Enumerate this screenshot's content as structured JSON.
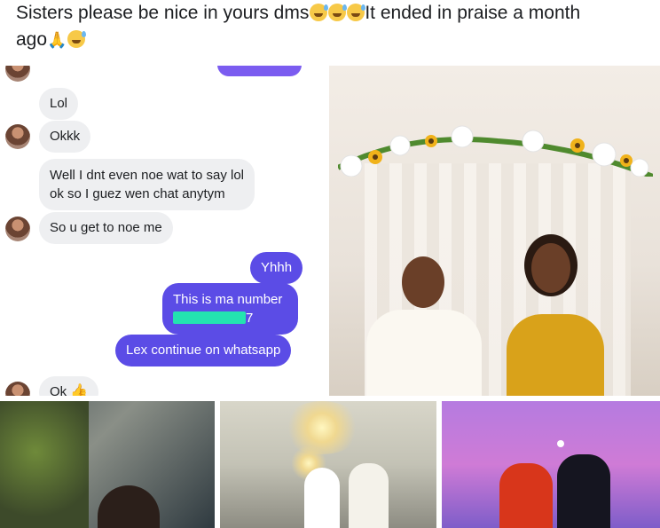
{
  "post": {
    "text_line1": "Sisters please be nice in yours dms",
    "text_line1_after": "It ended in praise a month",
    "text_line2": "ago"
  },
  "chat": {
    "messages": [
      {
        "side": "in",
        "text": "Lol"
      },
      {
        "side": "in",
        "text": "Okkk"
      },
      {
        "side": "in",
        "text": "Well I dnt even noe wat to say lol"
      },
      {
        "side": "in",
        "text": "ok so I guez wen chat anytym"
      },
      {
        "side": "in",
        "text": "So u get to noe me"
      },
      {
        "side": "out",
        "text": "Yhhh"
      },
      {
        "side": "out",
        "text": "This is ma number"
      },
      {
        "side": "out",
        "text": "7"
      },
      {
        "side": "out",
        "text": "Lex continue on whatsapp"
      },
      {
        "side": "in",
        "text": "Ok"
      }
    ]
  },
  "colors": {
    "outgoing_bubble": "#5b4ce6",
    "incoming_bubble": "#eeeff1",
    "redaction": "#23e3b0"
  },
  "photos": [
    "wedding-ceremony-photo",
    "couple-outdoor-photo",
    "couple-reception-photo",
    "couple-party-photo"
  ]
}
